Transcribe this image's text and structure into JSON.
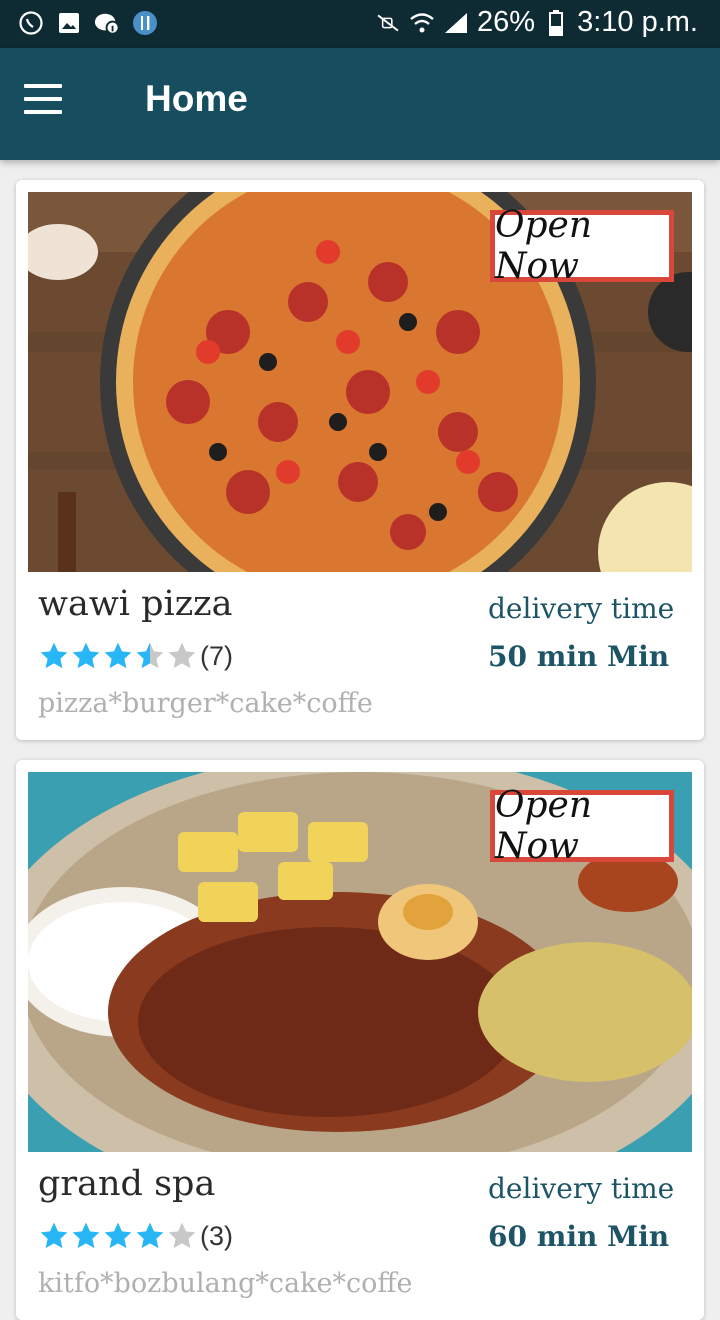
{
  "status_bar": {
    "battery": "26%",
    "time": "3:10 p.m.",
    "icons": [
      "whatsapp-icon",
      "image-icon",
      "chat-info-icon",
      "restaurant-icon",
      "mute-icon",
      "wifi-icon",
      "signal-icon",
      "battery-icon"
    ]
  },
  "app_bar": {
    "title": "Home",
    "menu_icon": "hamburger-menu-icon"
  },
  "colors": {
    "status_bar": "#0e2a33",
    "app_bar": "#164e60",
    "accent_text": "#1d5466",
    "star_filled": "#29b6f6",
    "star_empty": "#c8c8c8",
    "badge_border": "#d9473a"
  },
  "restaurants": [
    {
      "name": "wawi pizza",
      "badge": "Open Now",
      "rating": 3.5,
      "rating_count": "(7)",
      "tags": "pizza*burger*cake*coffe",
      "delivery_label": "delivery time",
      "delivery_value": "50 min Min"
    },
    {
      "name": "grand spa",
      "badge": "Open Now",
      "rating": 4,
      "rating_count": "(3)",
      "tags": "kitfo*bozbulang*cake*coffe",
      "delivery_label": "delivery time",
      "delivery_value": "60 min Min"
    }
  ]
}
